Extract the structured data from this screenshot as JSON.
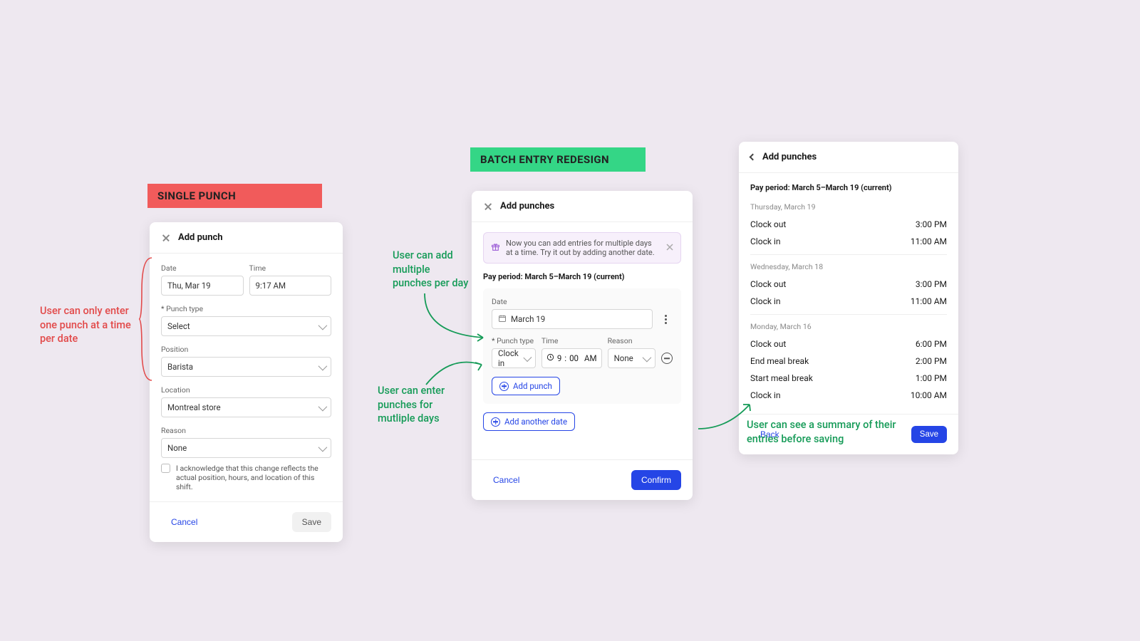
{
  "tags": {
    "single": "SINGLE PUNCH",
    "batch": "BATCH ENTRY REDESIGN"
  },
  "single": {
    "title": "Add punch",
    "date_label": "Date",
    "date_value": "Thu, Mar 19",
    "time_label": "Time",
    "time_value": "9:17 AM",
    "type_label": "Punch type",
    "type_value": "Select",
    "position_label": "Position",
    "position_value": "Barista",
    "location_label": "Location",
    "location_value": "Montreal store",
    "reason_label": "Reason",
    "reason_value": "None",
    "ack_text": "I acknowledge that this change reflects the actual position, hours, and location of this shift.",
    "cancel": "Cancel",
    "save": "Save"
  },
  "batch": {
    "title": "Add punches",
    "banner_text": "Now you can add entries for multiple days at a time. Try it out by adding another date.",
    "period": "Pay period: March 5–March 19 (current)",
    "date_label": "Date",
    "date_value": "March 19",
    "type_label": "Punch type",
    "type_value": "Clock in",
    "time_label": "Time",
    "time_h": "9",
    "time_m": "00",
    "time_ampm": "AM",
    "reason_label": "Reason",
    "reason_value": "None",
    "add_punch": "Add punch",
    "add_date": "Add another date",
    "cancel": "Cancel",
    "confirm": "Confirm"
  },
  "summary": {
    "title": "Add punches",
    "period": "Pay period: March 5–March 19 (current)",
    "days": [
      {
        "label": "Thursday, March 19",
        "rows": [
          {
            "name": "Clock out",
            "time": "3:00 PM"
          },
          {
            "name": "Clock in",
            "time": "11:00 AM"
          }
        ]
      },
      {
        "label": "Wednesday, March 18",
        "rows": [
          {
            "name": "Clock out",
            "time": "3:00 PM"
          },
          {
            "name": "Clock in",
            "time": "11:00 AM"
          }
        ]
      },
      {
        "label": "Monday, March 16",
        "rows": [
          {
            "name": "Clock out",
            "time": "6:00 PM"
          },
          {
            "name": "End meal break",
            "time": "2:00 PM"
          },
          {
            "name": "Start meal break",
            "time": "1:00 PM"
          },
          {
            "name": "Clock in",
            "time": "10:00 AM"
          }
        ]
      }
    ],
    "back": "Back",
    "save": "Save"
  },
  "annotations": {
    "a_red": "User can only enter one punch at a time per date",
    "a1": "User can add multiple punches per day",
    "a2": "User can enter punches for mutliple days",
    "a3": "User can see a summary of their entries before saving"
  }
}
